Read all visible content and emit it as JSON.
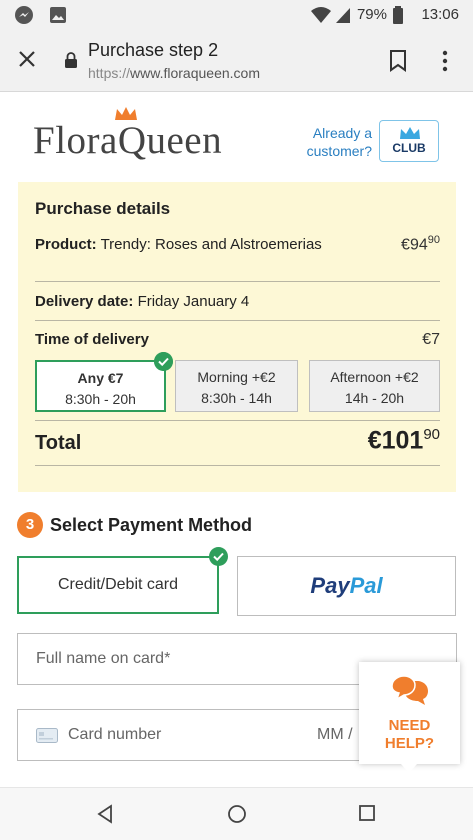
{
  "status_bar": {
    "time": "13:06",
    "battery": "79%",
    "icons": [
      "messenger-icon",
      "gallery-icon",
      "wifi-icon",
      "signal-icon",
      "battery-icon"
    ]
  },
  "browser": {
    "page_title": "Purchase step 2",
    "url_scheme": "https://",
    "url_host": "www.floraqueen.com"
  },
  "header": {
    "logo_part1": "Flora",
    "logo_part2": "Queen",
    "already_customer": "Already a customer?",
    "club_label": "CLUB"
  },
  "purchase_details": {
    "heading": "Purchase details",
    "product_label": "Product:",
    "product_value": "Trendy: Roses and Alstroemerias",
    "product_price_main": "€94",
    "product_price_cents": "90",
    "delivery_label": "Delivery date:",
    "delivery_value": "Friday January 4",
    "time_label": "Time of delivery",
    "time_price": "€7",
    "slots": [
      {
        "title": "Any €7",
        "hours": "8:30h - 20h"
      },
      {
        "title": "Morning +€2",
        "hours": "8:30h - 14h"
      },
      {
        "title": "Afternoon +€2",
        "hours": "14h - 20h"
      }
    ],
    "total_label": "Total",
    "total_main": "€101",
    "total_cents": "90"
  },
  "payment": {
    "step_number": "3",
    "title": "Select Payment Method",
    "card_option": "Credit/Debit card",
    "paypal_part1": "Pay",
    "paypal_part2": "Pal",
    "name_placeholder": "Full name on card*",
    "card_number_placeholder": "Card number",
    "expiry_placeholder": "MM /"
  },
  "help": {
    "line1": "NEED",
    "line2": "HELP?"
  },
  "colors": {
    "accent_green": "#2e9e5b",
    "accent_orange": "#f07e2d",
    "panel_yellow": "#fdf8d6",
    "link_blue": "#2a7fc1"
  }
}
